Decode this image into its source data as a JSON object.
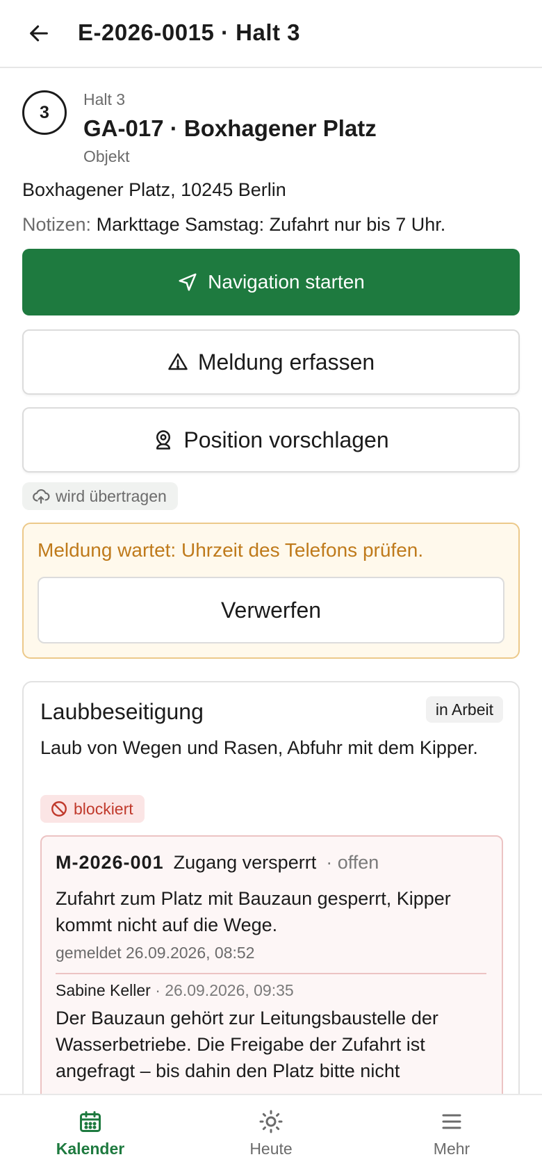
{
  "header": {
    "back_icon": "arrow-left-icon",
    "title": "E-2026-0015 · Halt 3"
  },
  "stop": {
    "number": "3",
    "kicker": "Halt 3",
    "name": "GA-017 · Boxhagener Platz",
    "type": "Objekt",
    "address": "Boxhagener Platz, 10245 Berlin",
    "notes_label": "Notizen:",
    "notes": "Markttage Samstag: Zufahrt nur bis 7 Uhr."
  },
  "actions": {
    "navigate": {
      "label": "Navigation starten",
      "icon": "navigation-arrow-icon"
    },
    "report": {
      "label": "Meldung erfassen",
      "icon": "warning-triangle-icon"
    },
    "position": {
      "label": "Position vorschlagen",
      "icon": "map-pin-user-icon"
    }
  },
  "sync": {
    "icon": "cloud-upload-icon",
    "label": "wird übertragen"
  },
  "pending_warning": {
    "message": "Meldung wartet: Uhrzeit des Telefons prüfen.",
    "discard_label": "Verwerfen"
  },
  "task": {
    "title": "Laubbeseitigung",
    "status": "in Arbeit",
    "description": "Laub von Wegen und Rasen, Abfuhr mit dem Kipper.",
    "blocked_label": "blockiert",
    "blocked_icon": "ban-icon",
    "issue": {
      "id": "M-2026-001",
      "title": "Zugang versperrt",
      "state": "· offen",
      "description": "Zufahrt zum Platz mit Bauzaun gesperrt, Kipper kommt nicht auf die Wege.",
      "reported": "gemeldet 26.09.2026, 08:52",
      "comment": {
        "author": "Sabine Keller",
        "meta": " · 26.09.2026, 09:35",
        "text": "Der Bauzaun gehört zur Leitungsbaustelle der Wasserbetriebe. Die Freigabe der Zufahrt ist angefragt – bis dahin den Platz bitte nicht"
      }
    }
  },
  "bottom_nav": [
    {
      "label": "Kalender",
      "icon": "calendar-icon",
      "active": true
    },
    {
      "label": "Heute",
      "icon": "sun-icon",
      "active": false
    },
    {
      "label": "Mehr",
      "icon": "menu-icon",
      "active": false
    }
  ],
  "colors": {
    "primary": "#1e7a3f",
    "warning_text": "#bf7a1b",
    "warning_border": "#ecc98a",
    "danger": "#c0392b",
    "danger_border": "#ecc3c3"
  }
}
